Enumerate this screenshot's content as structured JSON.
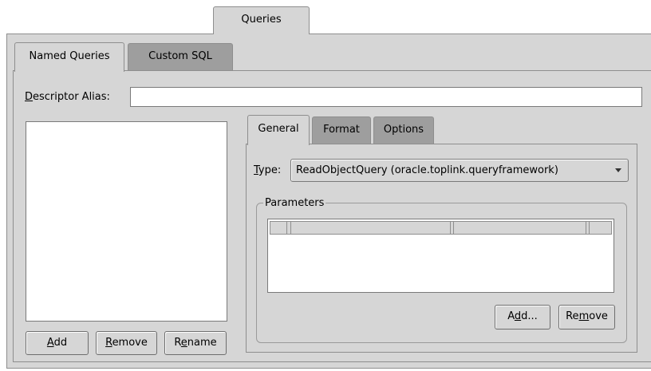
{
  "outer_tab": {
    "label": "Queries"
  },
  "query_tabs": [
    {
      "label": "Named Queries",
      "active": true
    },
    {
      "label": "Custom SQL",
      "active": false
    }
  ],
  "descriptor_alias": {
    "label_mnemonic": "D",
    "label_rest": "escriptor Alias:",
    "value": ""
  },
  "query_list": {
    "items": []
  },
  "list_buttons": {
    "add": {
      "mnemonic": "A",
      "rest": "dd"
    },
    "remove": {
      "mnemonic": "R",
      "rest": "emove"
    },
    "rename": {
      "pre": "R",
      "mnemonic": "e",
      "rest": "name"
    }
  },
  "detail_tabs": [
    {
      "label": "General",
      "active": true
    },
    {
      "label": "Format",
      "active": false
    },
    {
      "label": "Options",
      "active": false
    }
  ],
  "type_field": {
    "label_mnemonic": "T",
    "label_rest": "ype:",
    "selected": "ReadObjectQuery (oracle.toplink.queryframework)",
    "arrow_icon": "dropdown-arrow-icon"
  },
  "parameters": {
    "legend": "Parameters",
    "add_button": {
      "pre": "A",
      "mnemonic": "d",
      "rest": "d..."
    },
    "remove_button": {
      "pre": "Re",
      "mnemonic": "m",
      "rest": "ove"
    }
  },
  "colors": {
    "panel": "#d6d6d6",
    "inactive_tab": "#9e9e9e",
    "field": "#ffffff"
  }
}
